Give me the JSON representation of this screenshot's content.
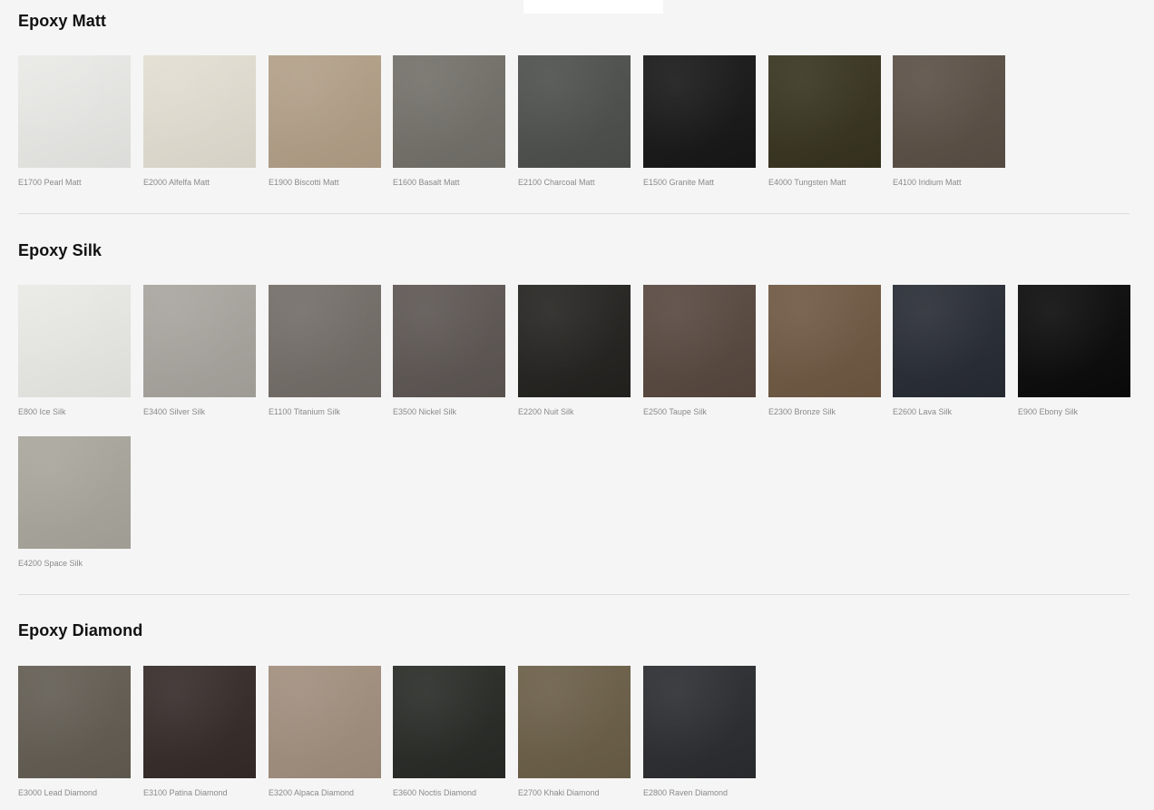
{
  "sections": [
    {
      "title": "Epoxy Matt",
      "swatches": [
        {
          "label": "E1700 Pearl Matt",
          "color": "#e9eae6"
        },
        {
          "label": "E2000 Alfelfa Matt",
          "color": "#e3ded2"
        },
        {
          "label": "E1900 Biscotti Matt",
          "color": "#b29f87"
        },
        {
          "label": "E1600 Basalt Matt",
          "color": "#727069"
        },
        {
          "label": "E2100 Charcoal Matt",
          "color": "#4c4f4b"
        },
        {
          "label": "E1500 Granite Matt",
          "color": "#171718"
        },
        {
          "label": "E4000 Tungsten Matt",
          "color": "#37331f"
        },
        {
          "label": "E4100 Iridium Matt",
          "color": "#5a4f45"
        }
      ]
    },
    {
      "title": "Epoxy Silk",
      "swatches": [
        {
          "label": "E800 Ice Silk",
          "color": "#e9eae5"
        },
        {
          "label": "E3400 Silver Silk",
          "color": "#a8a59f"
        },
        {
          "label": "E1100 Titanium Silk",
          "color": "#736d68"
        },
        {
          "label": "E3500 Nickel Silk",
          "color": "#5d5653"
        },
        {
          "label": "E2200 Nuit Silk",
          "color": "#23221f"
        },
        {
          "label": "E2500 Taupe Silk",
          "color": "#57483f"
        },
        {
          "label": "E2300 Bronze Silk",
          "color": "#6e5842"
        },
        {
          "label": "E2600 Lava Silk",
          "color": "#272b33"
        },
        {
          "label": "E900 Ebony Silk",
          "color": "#0b0a0a"
        },
        {
          "label": "E4200 Space Silk",
          "color": "#a9a69c"
        }
      ]
    },
    {
      "title": "Epoxy Diamond",
      "swatches": [
        {
          "label": "E3000 Lead Diamond",
          "color": "#625c52"
        },
        {
          "label": "E3100 Patina Diamond",
          "color": "#352b29"
        },
        {
          "label": "E3200 Alpaca Diamond",
          "color": "#a18e7d"
        },
        {
          "label": "E3600 Noctis Diamond",
          "color": "#272a25"
        },
        {
          "label": "E2700 Khaki Diamond",
          "color": "#6a5e47"
        },
        {
          "label": "E2800 Raven Diamond",
          "color": "#2a2c2f"
        }
      ]
    }
  ]
}
